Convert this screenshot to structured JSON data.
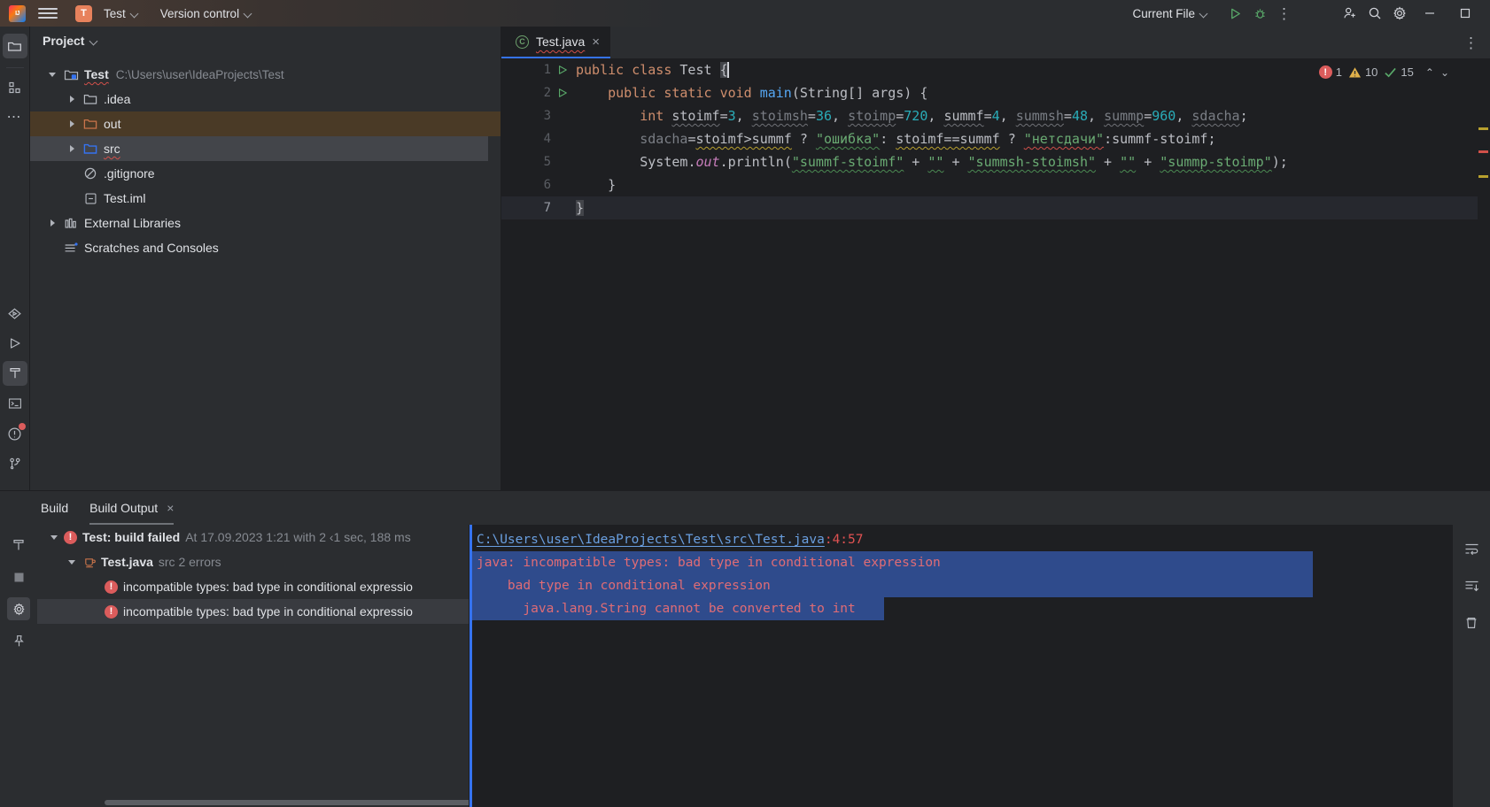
{
  "toolbar": {
    "logo": "IJ",
    "burger_name": "main-menu",
    "project_chip": "T",
    "project_name": "Test",
    "version_control": "Version control",
    "run_config": "Current File",
    "icons": [
      "run-icon",
      "debug-icon",
      "more-actions-icon",
      "add-collaborator-icon",
      "search-icon",
      "settings-gear-icon"
    ],
    "window": [
      "minimize",
      "maximize"
    ]
  },
  "rail": {
    "icons": [
      "project-folder-icon",
      "structure-icon",
      "more-tool-windows-icon",
      "services-icon",
      "run-tool-icon",
      "build-tool-icon",
      "terminal-icon",
      "problems-icon",
      "version-control-branch-icon"
    ]
  },
  "project_panel": {
    "title": "Project",
    "tree": [
      {
        "label": "Test",
        "sub": "C:\\Users\\user\\IdeaProjects\\Test",
        "icon": "project-root-icon",
        "depth": 0,
        "twisty": "down",
        "bold": true,
        "error": true,
        "state": "normal"
      },
      {
        "label": ".idea",
        "sub": "",
        "icon": "folder-icon",
        "depth": 1,
        "twisty": "right",
        "bold": false,
        "error": false,
        "state": "normal"
      },
      {
        "label": "out",
        "sub": "",
        "icon": "folder-excluded-icon",
        "depth": 1,
        "twisty": "right",
        "bold": false,
        "error": false,
        "state": "highlighted"
      },
      {
        "label": "src",
        "sub": "",
        "icon": "folder-source-icon",
        "depth": 1,
        "twisty": "right",
        "bold": false,
        "error": true,
        "state": "selected"
      },
      {
        "label": ".gitignore",
        "sub": "",
        "icon": "gitignore-icon",
        "depth": 2,
        "twisty": "none",
        "bold": false,
        "error": false,
        "state": "normal"
      },
      {
        "label": "Test.iml",
        "sub": "",
        "icon": "iml-file-icon",
        "depth": 2,
        "twisty": "none",
        "bold": false,
        "error": false,
        "state": "normal"
      },
      {
        "label": "External Libraries",
        "sub": "",
        "icon": "libraries-icon",
        "depth": 0,
        "twisty": "right",
        "bold": false,
        "error": false,
        "state": "normal"
      },
      {
        "label": "Scratches and Consoles",
        "sub": "",
        "icon": "scratches-icon",
        "depth": 0,
        "twisty": "none",
        "bold": false,
        "error": false,
        "state": "normal"
      }
    ]
  },
  "editor": {
    "tab_label": "Test.java",
    "tab_icon": "java-class-icon",
    "tab_close": "×",
    "kebab": "⋮",
    "inspections": {
      "errors": "1",
      "warnings": "10",
      "ok": "15",
      "up": "⌃",
      "down": "⌄"
    },
    "lines": [
      {
        "n": "1",
        "run": true
      },
      {
        "n": "2",
        "run": true
      },
      {
        "n": "3",
        "run": false
      },
      {
        "n": "4",
        "run": false
      },
      {
        "n": "5",
        "run": false
      },
      {
        "n": "6",
        "run": false
      },
      {
        "n": "7",
        "run": false
      }
    ],
    "code": {
      "l1": {
        "kw1": "public",
        "kw2": "class",
        "name": "Test",
        "brace": "{"
      },
      "l2": {
        "kw1": "public",
        "kw2": "static",
        "kw3": "void",
        "meth": "main",
        "params": "(String[] args) {"
      },
      "l3": {
        "kw": "int",
        "v1": "stoimf",
        "n1": "3",
        "v2": "stoimsh",
        "n2": "36",
        "v3": "stoimp",
        "n3": "720",
        "v4": "summf",
        "n4": "4",
        "v5": "summsh",
        "n5": "48",
        "v6": "summp",
        "n6": "960",
        "v7": "sdacha",
        "semi": ";"
      },
      "l4": {
        "lhs": "sdacha",
        "eq": "=",
        "c1": "stoimf>summf",
        "q1": "?",
        "s1": "\"ошибка\"",
        "colon1": ":",
        "c2": "stoimf==summf",
        "q2": "?",
        "s2": "\"нетсдачи\"",
        "rest": ":summf-stoimf;"
      },
      "l5": {
        "sys": "System",
        "dot1": ".",
        "out": "out",
        "dot2": ".",
        "println": "println",
        "p1": "(",
        "s1": "\"summf-stoimf\"",
        "plus1": " + ",
        "s2": "\"\"",
        "plus2": " + ",
        "s3": "\"summsh-stoimsh\"",
        "plus3": " + ",
        "s4": "\"\"",
        "plus4": " + ",
        "s5": "\"summp-stoimp\"",
        "p2": ");"
      },
      "l6": {
        "brace": "}"
      },
      "l7": {
        "brace": "}"
      }
    },
    "markers": [
      "#b8a02e",
      "#d1504a",
      "#b8a02e"
    ]
  },
  "build": {
    "tabs": [
      {
        "label": "Build",
        "closable": false,
        "active": false
      },
      {
        "label": "Build Output",
        "closable": true,
        "active": true
      }
    ],
    "tab_close": "×",
    "rail_icons": [
      "build-hammer-icon",
      "stop-icon",
      "settings-gear-icon",
      "pin-icon"
    ],
    "tree": [
      {
        "depth": 0,
        "twisty": "down",
        "error": true,
        "icon": "error-icon",
        "strong": "Test: build failed",
        "dim": "At 17.09.2023 1:21 with 2 ‹1 sec, 188 ms",
        "selected": false
      },
      {
        "depth": 1,
        "twisty": "down",
        "error": false,
        "icon": "java-file-icon",
        "strong": "Test.java",
        "dim": "src 2 errors",
        "selected": false
      },
      {
        "depth": 2,
        "twisty": "none",
        "error": true,
        "icon": "error-icon",
        "strong": "",
        "reg": "incompatible types: bad type in conditional expressio",
        "dim": "",
        "selected": false
      },
      {
        "depth": 2,
        "twisty": "none",
        "error": true,
        "icon": "error-icon",
        "strong": "",
        "reg": "incompatible types: bad type in conditional expressio",
        "dim": "",
        "selected": true
      }
    ],
    "console": {
      "path": "C:\\Users\\user\\IdeaProjects\\Test\\src\\Test.java",
      "location": ":4:57",
      "line1": "java: incompatible types: bad type in conditional expression",
      "line2": "    bad type in conditional expression",
      "line3": "      java.lang.String cannot be converted to int"
    },
    "right_icons": [
      "soft-wrap-icon",
      "scroll-to-end-icon",
      "trash-icon"
    ]
  },
  "colors": {
    "accent_blue": "#3573f0",
    "error_red": "#db5c5c",
    "warn_yellow": "#b8a02e",
    "string_green": "#6aab73",
    "keyword_orange": "#cf8e6d",
    "number_cyan": "#2aacb8",
    "selection_blue": "#2f4b8c"
  }
}
